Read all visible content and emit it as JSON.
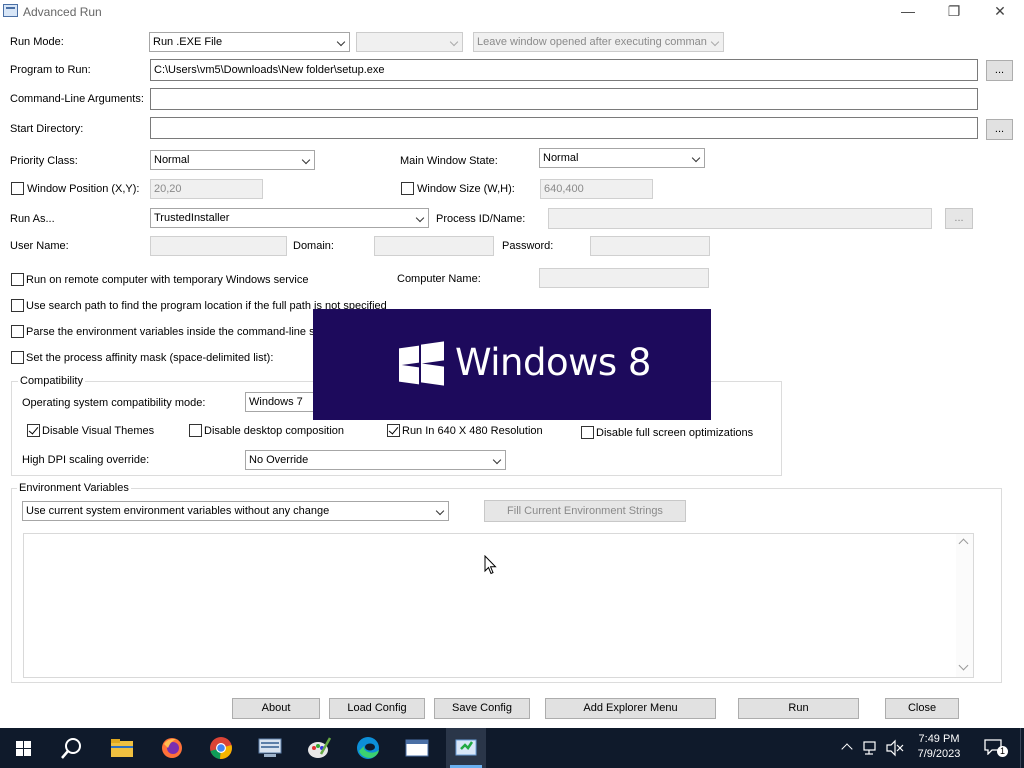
{
  "window": {
    "title": "Advanced Run"
  },
  "labels": {
    "run_mode": "Run Mode:",
    "program": "Program to Run:",
    "args": "Command-Line Arguments:",
    "start_dir": "Start Directory:",
    "priority": "Priority Class:",
    "main_state": "Main Window State:",
    "win_pos": "Window Position (X,Y):",
    "win_size": "Window Size (W,H):",
    "run_as": "Run As...",
    "process_id": "Process ID/Name:",
    "user_name": "User Name:",
    "domain": "Domain:",
    "password": "Password:",
    "remote": "Run on remote computer with temporary Windows service",
    "computer_name": "Computer Name:",
    "search_path": "Use search path to find the program location if the full path is not specified",
    "parse_env": "Parse the environment variables inside the command-line st",
    "affinity": "Set the process affinity mask (space-delimited list):",
    "compat_group": "Compatibility",
    "os_compat": "Operating system compatibility mode:",
    "disable_themes": "Disable Visual Themes",
    "disable_desktop": "Disable desktop composition",
    "run_640": "Run In 640 X 480 Resolution",
    "disable_fullscreen": "Disable full screen optimizations",
    "high_dpi": "High DPI scaling override:",
    "env_group": "Environment Variables"
  },
  "values": {
    "run_mode": "Run .EXE File",
    "run_mode_extra": "",
    "leave_window": "Leave window opened after executing comman",
    "program": "C:\\Users\\vm5\\Downloads\\New folder\\setup.exe",
    "args": "",
    "start_dir": "",
    "priority": "Normal",
    "main_state": "Normal",
    "win_pos": "20,20",
    "win_size": "640,400",
    "run_as": "TrustedInstaller",
    "process_id": "",
    "user_name": "",
    "domain": "",
    "password": "",
    "computer_name": "",
    "os_compat": "Windows 7",
    "high_dpi": "No Override",
    "env_mode": "Use current system environment variables without any change"
  },
  "checks": {
    "win_pos": false,
    "win_size": false,
    "remote": false,
    "search_path": false,
    "parse_env": false,
    "affinity": false,
    "disable_themes": true,
    "disable_desktop": false,
    "run_640": true,
    "disable_fullscreen": false
  },
  "buttons": {
    "browse": "...",
    "fill_env": "Fill Current Environment Strings",
    "about": "About",
    "load_config": "Load Config",
    "save_config": "Save Config",
    "add_explorer": "Add Explorer Menu",
    "run": "Run",
    "close": "Close"
  },
  "overlay": {
    "text": "Windows 8"
  },
  "taskbar": {
    "time": "7:49 PM",
    "date": "7/9/2023",
    "notifications": "1",
    "icons": [
      "start-icon",
      "search-icon",
      "file-explorer-icon",
      "firefox-icon",
      "chrome-icon",
      "network-app-icon",
      "paint-icon",
      "edge-icon",
      "window-app-icon",
      "advanced-run-icon"
    ]
  }
}
